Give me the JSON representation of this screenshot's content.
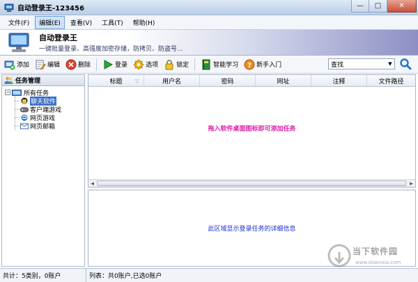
{
  "window": {
    "title": "自动登录王-123456"
  },
  "menu": {
    "items": [
      {
        "label": "文件(F)",
        "active": false
      },
      {
        "label": "编辑(E)",
        "active": true
      },
      {
        "label": "查看(V)",
        "active": false
      },
      {
        "label": "工具(T)",
        "active": false
      },
      {
        "label": "帮助(H)",
        "active": false
      }
    ]
  },
  "banner": {
    "title": "自动登录王",
    "subtitle": "一键批量登录、高强度加密存储，防拷贝、防盗号..."
  },
  "toolbar": {
    "add": "添加",
    "edit": "编辑",
    "delete": "删除",
    "login": "登录",
    "options": "选项",
    "lock": "锁定",
    "smart_learn": "智能学习",
    "beginner": "新手入门",
    "search_value": "查找"
  },
  "left_panel": {
    "header": "任务管理",
    "root": "所有任务",
    "children": [
      {
        "label": "聊天软件",
        "selected": true
      },
      {
        "label": "客户端游戏",
        "selected": false
      },
      {
        "label": "网页游戏",
        "selected": false
      },
      {
        "label": "网页邮箱",
        "selected": false
      }
    ]
  },
  "table": {
    "columns": [
      "标题",
      "用户名",
      "密码",
      "网址",
      "注释",
      "文件路径"
    ],
    "empty_hint": "拖入软件桌面图标即可添加任务"
  },
  "detail": {
    "hint": "此区域显示登录任务的详细信息"
  },
  "statusbar": {
    "left": "共计：5类别，0账户",
    "right": "列表：共0账户,已选0账户"
  },
  "watermark": {
    "text": "当下软件园",
    "url": "www.downxia.com"
  }
}
